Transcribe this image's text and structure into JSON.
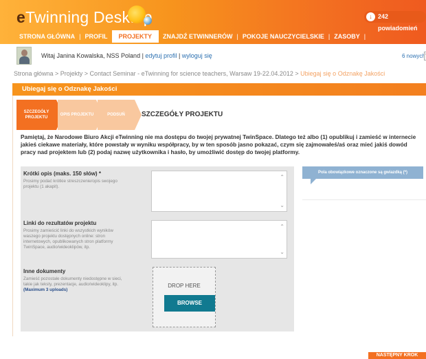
{
  "header": {
    "logo_e": "e",
    "logo_twinning": "Twinning",
    "logo_desktop": "Desktop",
    "notifications": "242 powiadomień",
    "accent_color": "#f37021"
  },
  "nav": {
    "items": [
      "STRONA GŁÓWNA",
      "PROFIL",
      "PROJEKTY",
      "ZNAJDŹ ETWINNERÓW",
      "POKOJE NAUCZYCIELSKIE",
      "ZASOBY"
    ],
    "active": "PROJEKTY"
  },
  "userbar": {
    "welcome": "Witaj Janina Kowalska, NSS Poland",
    "edit_profile": "edytuj profil",
    "logout": "wyloguj się",
    "new_messages": "6 nowych"
  },
  "breadcrumb": {
    "path": "Strona główna > Projekty > Contact Seminar - eTwinning for science teachers, Warsaw 19-22.04.2012 >",
    "current": "Ubiegaj się o Odznakę Jakości"
  },
  "panel": {
    "title": "Ubiegaj się o Odznakę Jakości",
    "steps": [
      {
        "label": "SZCZEGÓŁY PROJEKTU"
      },
      {
        "label": "OPIS PROJEKTU"
      },
      {
        "label": "PODSUŃ"
      }
    ],
    "step_heading": "SZCZEGÓŁY PROJEKTU",
    "intro": "Pamiętaj, że Narodowe Biuro Akcji eTwinning nie ma dostępu do twojej prywatnej TwinSpace. Dlatego też albo (1) opublikuj i zamieść w internecie jakieś ciekawe materiały, które powstały w wyniku współpracy, by w ten sposób jasno pokazać, czym się zajmowałeś/aś oraz mieć jakiś dowód pracy nad projektem lub (2) podaj nazwę użytkownika i hasło, by umożliwić dostęp do twojej platformy."
  },
  "form": {
    "short_desc_label": "Krótki opis (maks. 150 słów) *",
    "short_desc_help": "Prosimy podać krótkie streszczenie/opis swojego projektu (1 akapit).",
    "links_label": "Linki do rezultatów projektu",
    "links_help": "Prosimy zamieścić linki do wszystkich wyników waszego projektu dostępnych online: stron internetowych, opublikowanych stron platformy TwinSpace, audio/wideoklipów, itp.",
    "other_docs_label": "Inne dokumenty",
    "other_docs_help": "Zamieść pozostałe dokumenty niedostępne w sieci, takie jak teksty, prezentacje, audio/wideoklipy, itp.",
    "other_docs_limit": "(Maximum 3 uploads)",
    "drop_here": "DROP HERE",
    "browse": "BROWSE"
  },
  "tooltip": "Pola obowiązkowe oznaczone są gwiazdką (*)",
  "next_button": "NASTĘPNY KROK"
}
